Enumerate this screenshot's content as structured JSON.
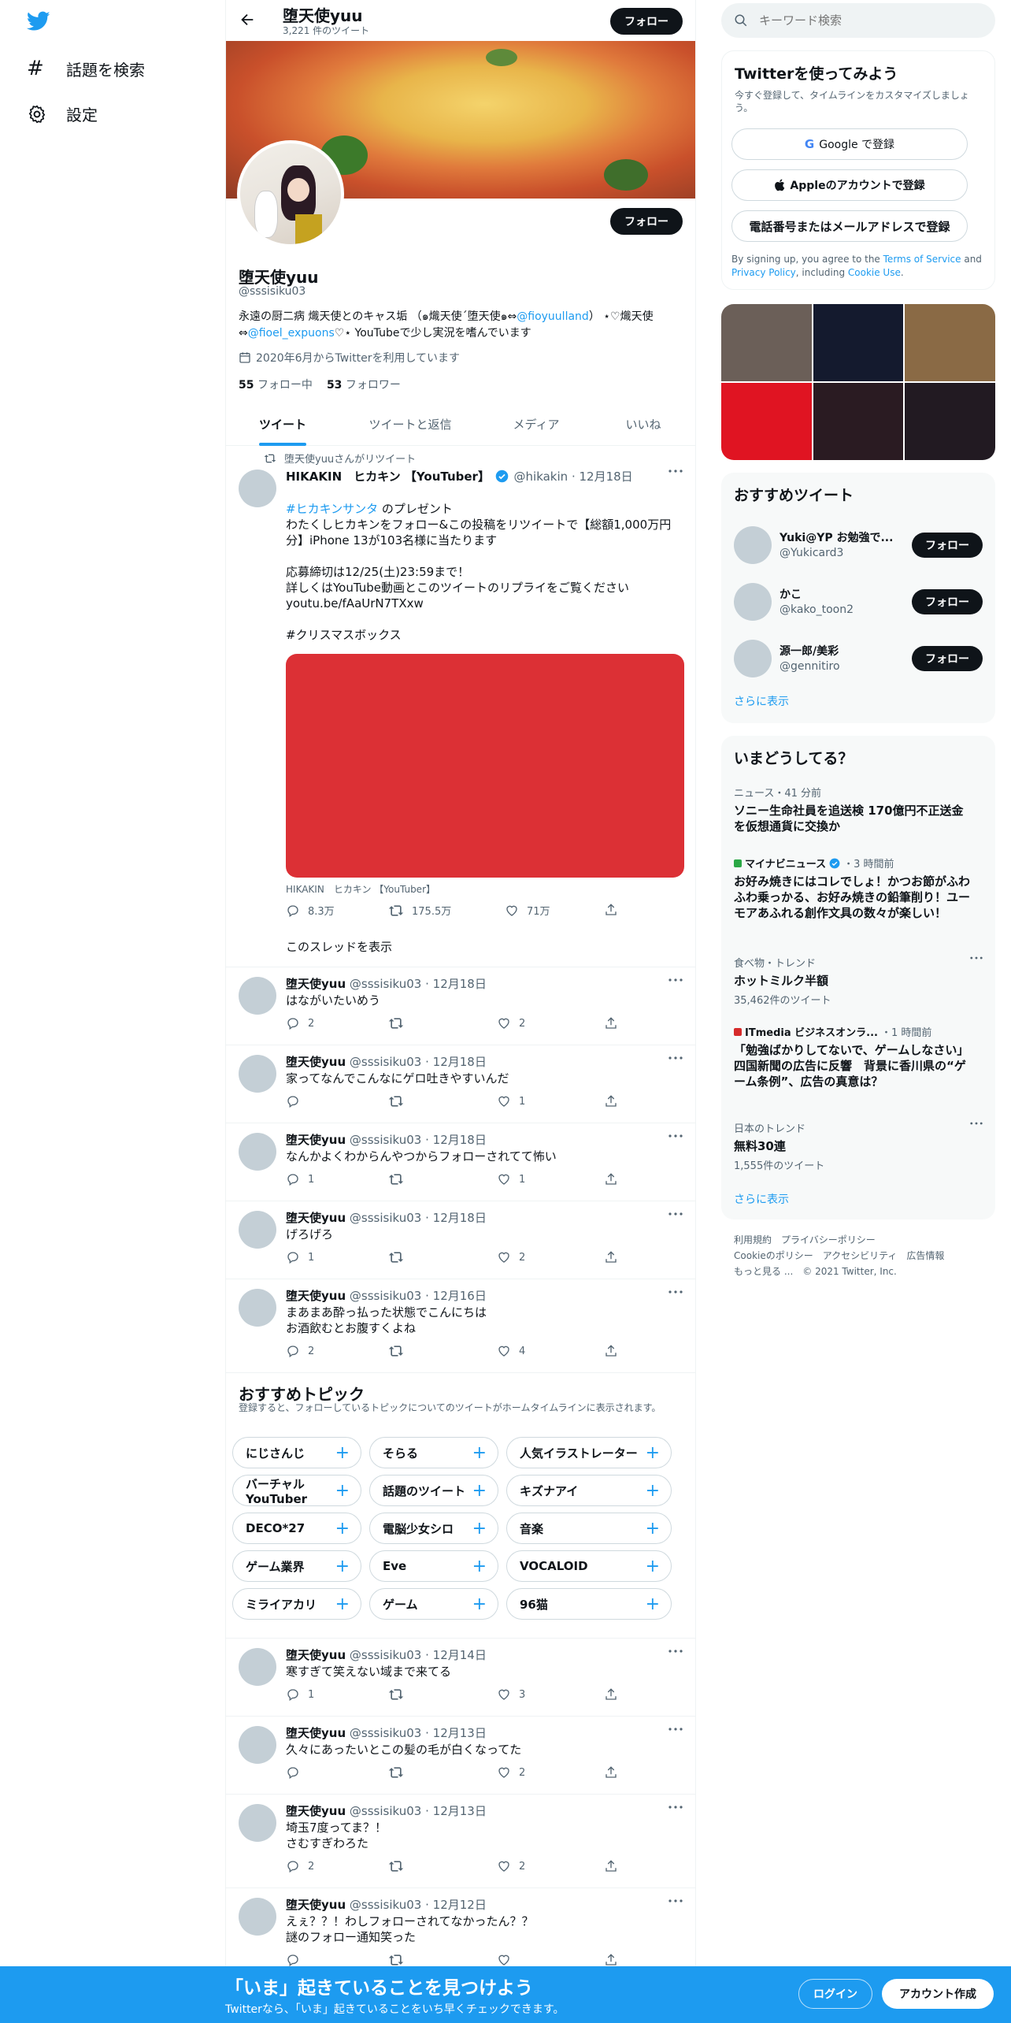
{
  "colors": {
    "accent": "#1d9bf0",
    "dark": "#0f1419",
    "muted": "#536471"
  },
  "nav": {
    "explore": "話題を検索",
    "settings": "設定"
  },
  "header": {
    "name": "堕天使yuu",
    "tweet_count": "3,221 件のツイート",
    "follow": "フォロー"
  },
  "profile": {
    "name": "堕天使yuu",
    "handle": "@sssisiku03",
    "follow": "フォロー",
    "bio_1": "永遠の厨二病 熾天使とのキャス垢 （๑熾天使ˊ堕天使๑⇔",
    "bio_link1": "@fioyuulland",
    "bio_2": "） ⋆♡熾天使⇔",
    "bio_link2": "@fioel_expuons",
    "bio_3": "♡⋆ YouTubeで少し実況を嗜んでいます",
    "joined": "2020年6月からTwitterを利用しています",
    "following_count": "55",
    "following_label": "フォロー中",
    "followers_count": "53",
    "followers_label": "フォロワー"
  },
  "tabs": [
    "ツイート",
    "ツイートと返信",
    "メディア",
    "いいね"
  ],
  "pinned": {
    "retweet_label": "堕天使yuuさんがリツイート",
    "name": "HIKAKIN　ヒカキン 【YouTuber】",
    "handle": "@hikakin",
    "date": "12月18日",
    "hashtag1": "#ヒカキンサンタ",
    "line1_rest": " のプレゼント",
    "line2": "わたくしヒカキンをフォロー&この投稿をリツイートで【総額1,000万円分】iPhone 13が103名様に当たります",
    "line3": "応募締切は12/25(土)23:59まで！",
    "line4": "詳しくはYouTube動画とこのツイートのリプライをご覧ください",
    "url": "youtu.be/fAaUrN7TXxw",
    "hashtag2": "#クリスマスボックス",
    "media_caption": "HIKAKIN　ヒカキン 【YouTuber】",
    "replies": "8.3万",
    "retweets": "175.5万",
    "likes": "71万",
    "show_thread": "このスレッドを表示"
  },
  "tweets": [
    {
      "name": "堕天使yuu",
      "handle": "@sssisiku03",
      "date": "12月18日",
      "text": "はながいたいめう",
      "replies": "2",
      "retweets": "",
      "likes": "2"
    },
    {
      "name": "堕天使yuu",
      "handle": "@sssisiku03",
      "date": "12月18日",
      "text": "家ってなんでこんなにゲロ吐きやすいんだ",
      "replies": "",
      "retweets": "",
      "likes": "1"
    },
    {
      "name": "堕天使yuu",
      "handle": "@sssisiku03",
      "date": "12月18日",
      "text": "なんかよくわからんやつからフォローされてて怖い",
      "replies": "1",
      "retweets": "",
      "likes": "1"
    },
    {
      "name": "堕天使yuu",
      "handle": "@sssisiku03",
      "date": "12月18日",
      "text": "げろげろ",
      "replies": "1",
      "retweets": "",
      "likes": "2"
    },
    {
      "name": "堕天使yuu",
      "handle": "@sssisiku03",
      "date": "12月16日",
      "text": "まあまあ酔っ払った状態でこんにちは\nお酒飲むとお腹すくよね",
      "replies": "2",
      "retweets": "",
      "likes": "4"
    },
    {
      "name": "堕天使yuu",
      "handle": "@sssisiku03",
      "date": "12月14日",
      "text": "寒すぎて笑えない域まで来てる",
      "replies": "1",
      "retweets": "",
      "likes": "3"
    },
    {
      "name": "堕天使yuu",
      "handle": "@sssisiku03",
      "date": "12月13日",
      "text": "久々にあったいとこの髪の毛が白くなってた",
      "replies": "",
      "retweets": "",
      "likes": "2"
    },
    {
      "name": "堕天使yuu",
      "handle": "@sssisiku03",
      "date": "12月13日",
      "text": "埼玉7度ってま？！\nさむすぎわろた",
      "replies": "2",
      "retweets": "",
      "likes": "2"
    },
    {
      "name": "堕天使yuu",
      "handle": "@sssisiku03",
      "date": "12月12日",
      "text": "えぇ？？！わしフォローされてなかったん？？\n謎のフォロー通知笑った",
      "replies": "",
      "retweets": "",
      "likes": ""
    }
  ],
  "topics": {
    "title": "おすすめトピック",
    "subtitle": "登録すると、フォローしているトピックについてのツイートがホームタイムラインに表示されます。",
    "items": [
      "にじさんじ",
      "そらる",
      "人気イラストレーター",
      "バーチャルYouTuber",
      "話題のツイート",
      "キズナアイ",
      "DECO*27",
      "電脳少女シロ",
      "音楽",
      "ゲーム業界",
      "Eve",
      "VOCALOID",
      "ミライアカリ",
      "ゲーム",
      "96猫"
    ]
  },
  "search": {
    "placeholder": "キーワード検索"
  },
  "signup": {
    "title": "Twitterを使ってみよう",
    "subtitle": "今すぐ登録して、タイムラインをカスタマイズしましょう。",
    "google": "Google で登録",
    "apple": "Appleのアカウントで登録",
    "phone": "電話番号またはメールアドレスで登録",
    "legal_1": "By signing up, you agree to the ",
    "tos": "Terms of Service",
    "legal_2": " and ",
    "privacy": "Privacy Policy",
    "legal_3": ", including ",
    "cookie": "Cookie Use",
    "legal_4": "."
  },
  "media_colors": [
    "#6b5f58",
    "#141a2e",
    "#8a6a45",
    "#e01422",
    "#2a1b22",
    "#221a22"
  ],
  "suggested": {
    "title": "おすすめツイート",
    "users": [
      {
        "name": "Yuki@YP お勉強で...",
        "handle": "@Yukicard3"
      },
      {
        "name": "かこ",
        "handle": "@kako_toon2"
      },
      {
        "name": "源一郎/美彩",
        "handle": "@gennitiro"
      }
    ],
    "follow": "フォロー",
    "show_more": "さらに表示"
  },
  "trends": {
    "title": "いまどうしてる？",
    "items": [
      {
        "meta": "ニュース・41 分前",
        "title": "ソニー生命社員を追送検 170億円不正送金を仮想通貨に交換か"
      },
      {
        "source": "マイナビニュース",
        "meta": "・3 時間前",
        "title": "お好み焼きにはコレでしょ！かつお節がふわふわ乗っかる、お好み焼きの鉛筆削り！ユーモアあふれる創作文具の数々が楽しい！"
      },
      {
        "meta": "食べ物・トレンド",
        "title": "ホットミルク半額",
        "count": "35,462件のツイート"
      },
      {
        "source": "ITmedia ビジネスオンラ...",
        "meta": "・1 時間前",
        "title": "「勉強ばかりしてないで、ゲームしなさい」　四国新聞の広告に反響　背景に香川県の“ゲーム条例”、広告の真意は？"
      },
      {
        "meta": "日本のトレンド",
        "title": "無料30連",
        "count": "1,555件のツイート"
      }
    ],
    "show_more": "さらに表示"
  },
  "footer": {
    "line1": [
      "利用規約",
      "プライバシーポリシー"
    ],
    "line2": [
      "Cookieのポリシー",
      "アクセシビリティ",
      "広告情報"
    ],
    "more": "もっと見る ...",
    "copyright": "© 2021 Twitter, Inc."
  },
  "bottombar": {
    "title": "「いま」起きていることを見つけよう",
    "subtitle": "Twitterなら、「いま」起きていることをいち早くチェックできます。",
    "login": "ログイン",
    "signup": "アカウント作成"
  }
}
